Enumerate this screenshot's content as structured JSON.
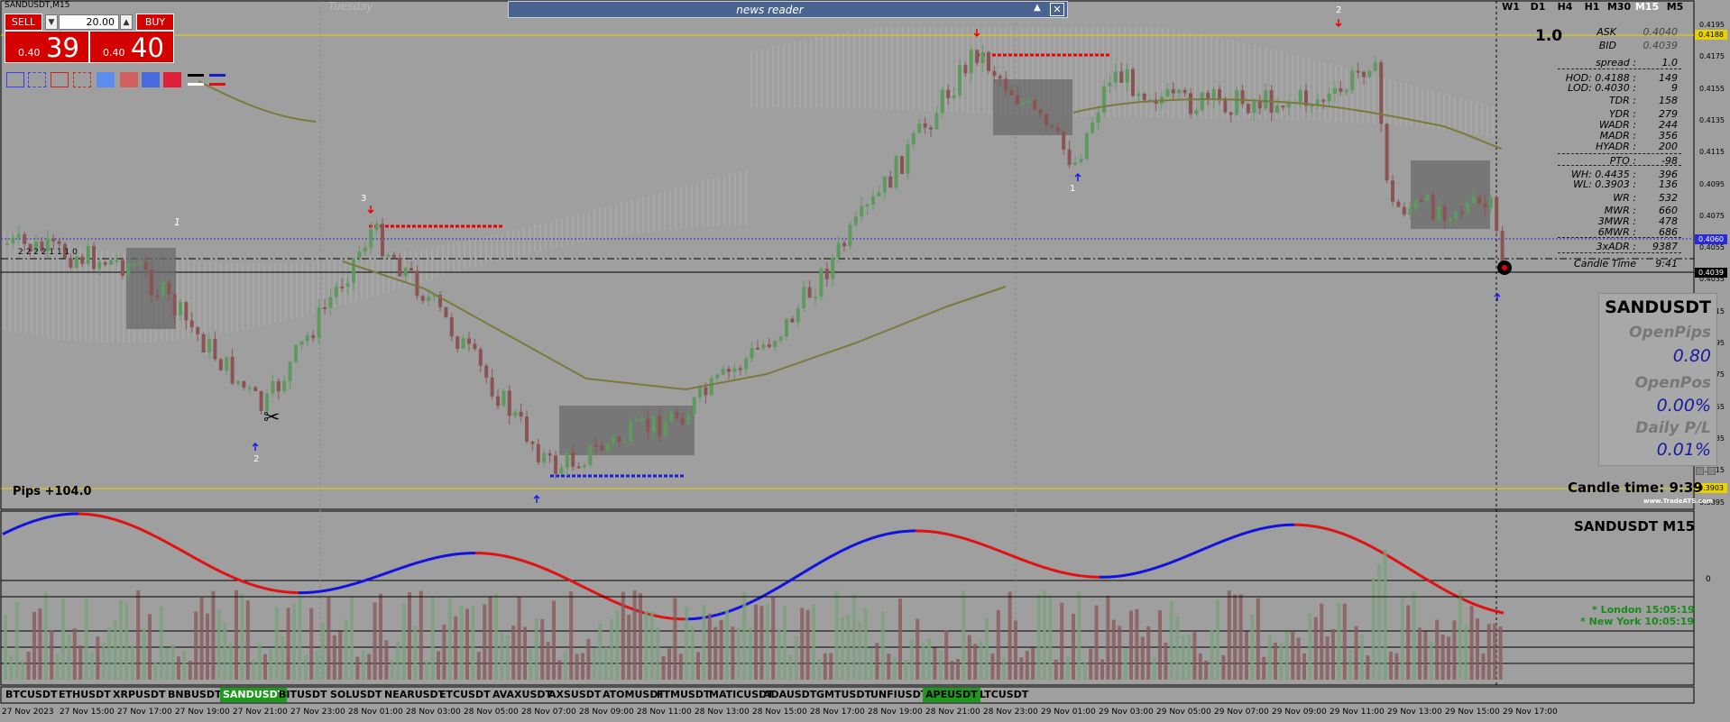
{
  "window": {
    "title": "SANDUSDT,M15"
  },
  "day_label": "Tuesday",
  "trade_panel": {
    "sell_label": "SELL",
    "buy_label": "BUY",
    "lot_value": "20.00",
    "sell_price_small": "0.40",
    "sell_price_big": "39",
    "buy_price_small": "0.40",
    "buy_price_big": "40",
    "dec_icon": "chevron-down-icon",
    "inc_icon": "chevron-up-icon"
  },
  "swatch_colors": [
    "#3a3aff",
    "#3a3aff",
    "#d02020",
    "#d02020",
    "#5b8def",
    "#d06060",
    "#4a6ae0",
    "#e0203a"
  ],
  "news_reader": {
    "title": "news reader",
    "collapse_icon": "triangle-up-icon",
    "close_icon": "close-icon"
  },
  "timeframes": [
    {
      "label": "W1",
      "active": false
    },
    {
      "label": "D1",
      "active": false
    },
    {
      "label": "H4",
      "active": false
    },
    {
      "label": "H1",
      "active": false
    },
    {
      "label": "M30",
      "active": false
    },
    {
      "label": "M15",
      "active": true
    },
    {
      "label": "M5",
      "active": false
    }
  ],
  "info_panel": {
    "spread_big": "1.0",
    "ask_label": "ASK",
    "ask_value": "0.4040",
    "bid_label": "BID",
    "bid_value": "0.4039",
    "spread_label": "spread :",
    "spread_value": "1.0",
    "hod_label": "HOD: 0.4188 :",
    "hod_value": "149",
    "lod_label": "LOD: 0.4030 :",
    "lod_value": "9",
    "tdr_label": "TDR :",
    "tdr_value": "158",
    "ydr_label": "YDR :",
    "ydr_value": "279",
    "wadr_label": "WADR :",
    "wadr_value": "244",
    "madr_label": "MADR :",
    "madr_value": "356",
    "hyadr_label": "HYADR :",
    "hyadr_value": "200",
    "pto_label": "PTO :",
    "pto_value": "-98",
    "wh_label": "WH: 0.4435 :",
    "wh_value": "396",
    "wl_label": "WL: 0.3903 :",
    "wl_value": "136",
    "wr_label": "WR :",
    "wr_value": "532",
    "mwr_label": "MWR :",
    "mwr_value": "660",
    "mwr3_label": "3MWR :",
    "mwr3_value": "478",
    "mwr6_label": "6MWR :",
    "mwr6_value": "686",
    "adr3x_label": "3xADR :",
    "adr3x_value": "9387",
    "candle_time_label": "Candle Time",
    "candle_time_value": "9:41"
  },
  "price_axis": [
    "0.4195",
    "0.4175",
    "0.4155",
    "0.4135",
    "0.4115",
    "0.4095",
    "0.4075",
    "0.4055",
    "0.4035",
    "0.4015",
    "0.3995",
    "0.3975",
    "0.3955",
    "0.3935",
    "0.3915",
    "0.3895"
  ],
  "price_tags": {
    "top": "0.4188",
    "blue": "0.4060",
    "black": "0.4039",
    "bottom": "0.3903"
  },
  "stats_box": {
    "symbol": "SANDUSDT",
    "open_pips_label": "OpenPips",
    "open_pips_value": "0.80",
    "open_pos_label": "OpenPos",
    "open_pos_value": "0.00%",
    "daily_pl_label": "Daily P/L",
    "daily_pl_value": "0.01%"
  },
  "candle_time_big": {
    "label": "Candle time:",
    "value": "9:39"
  },
  "brand": "www.TradeATS.com",
  "pips_label": "Pips +104.0",
  "level_labels": [
    "1",
    "3",
    "2",
    "1",
    "2",
    "2"
  ],
  "mini_label": "2 2 2 2 1 1 1 0",
  "sub_window": {
    "title": "SANDUSDT  M15",
    "london": "* London   15:05:19",
    "newyork": "* New York   10:05:19",
    "marker": "0"
  },
  "symbol_tabs": [
    {
      "label": "BTCUSDT",
      "active": false
    },
    {
      "label": "ETHUSDT",
      "active": false
    },
    {
      "label": "XRPUSDT",
      "active": false
    },
    {
      "label": "BNBUSDT",
      "active": false
    },
    {
      "label": "SANDUSDT",
      "active": true,
      "style": "white"
    },
    {
      "label": "BITUSDT",
      "active": false
    },
    {
      "label": "SOLUSDT",
      "active": false
    },
    {
      "label": "NEARUSDT",
      "active": false
    },
    {
      "label": "ETCUSDT",
      "active": false
    },
    {
      "label": "AVAXUSDT",
      "active": false
    },
    {
      "label": "AXSUSDT",
      "active": false
    },
    {
      "label": "ATOMUSDT",
      "active": false
    },
    {
      "label": "FTMUSDT",
      "active": false
    },
    {
      "label": "MATICUSDT",
      "active": false
    },
    {
      "label": "ADAUSDT",
      "active": false
    },
    {
      "label": "GMTUSDT",
      "active": false
    },
    {
      "label": "UNFIUSDT",
      "active": false
    },
    {
      "label": "APEUSDT",
      "active": true,
      "style": "black"
    },
    {
      "label": "LTCUSDT",
      "active": false
    }
  ],
  "time_axis": [
    "27 Nov 2023",
    "27 Nov 15:00",
    "27 Nov 17:00",
    "27 Nov 19:00",
    "27 Nov 21:00",
    "27 Nov 23:00",
    "28 Nov 01:00",
    "28 Nov 03:00",
    "28 Nov 05:00",
    "28 Nov 07:00",
    "28 Nov 09:00",
    "28 Nov 11:00",
    "28 Nov 13:00",
    "28 Nov 15:00",
    "28 Nov 17:00",
    "28 Nov 19:00",
    "28 Nov 21:00",
    "28 Nov 23:00",
    "29 Nov 01:00",
    "29 Nov 03:00",
    "29 Nov 05:00",
    "29 Nov 07:00",
    "29 Nov 09:00",
    "29 Nov 11:00",
    "29 Nov 13:00",
    "29 Nov 15:00",
    "29 Nov 17:00"
  ],
  "colors": {
    "bull": "#5e9a5e",
    "bear": "#8a5454",
    "osc_up": "#1010e0",
    "osc_down": "#e01010",
    "ma": "#7a7a3a",
    "hline_yellow": "#e8d300",
    "hline_blue": "#2a2ad8"
  }
}
